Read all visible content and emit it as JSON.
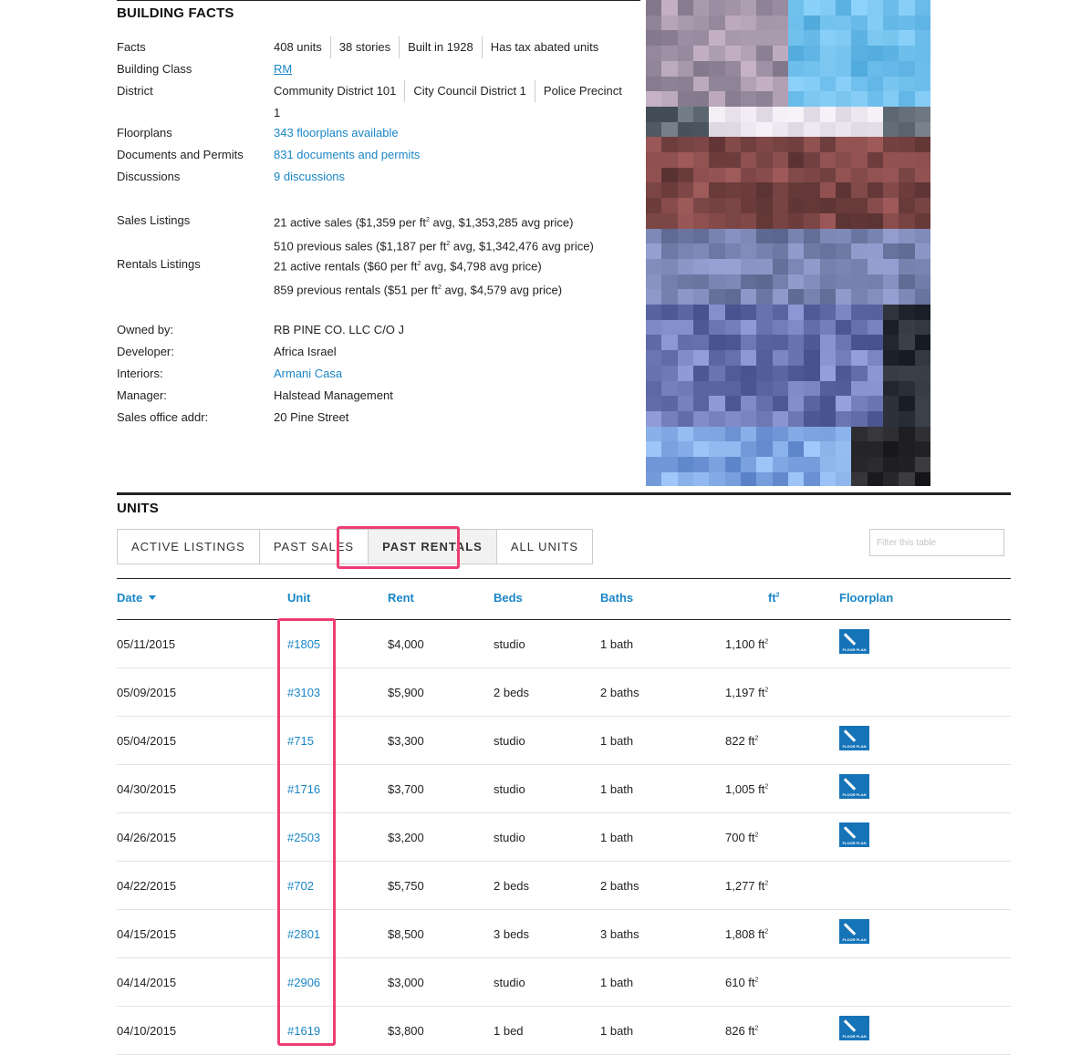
{
  "facts_section": {
    "title": "BUILDING FACTS",
    "rows": [
      {
        "label": "Facts",
        "values": [
          "408 units",
          "38 stories",
          "Built in 1928",
          "Has tax abated units"
        ]
      },
      {
        "label": "Building Class",
        "link": "RM"
      },
      {
        "label": "District",
        "values": [
          "Community District 101",
          "City Council District 1",
          "Police Precinct"
        ],
        "wrap": "1"
      },
      {
        "label": "Floorplans",
        "link": "343 floorplans available"
      },
      {
        "label": "Documents and Permits",
        "link": "831 documents and permits"
      },
      {
        "label": "Discussions",
        "link": "9 discussions"
      },
      {
        "label": "Sales Listings",
        "line1": {
          "pre": "21 active sales ($1,359 per ft",
          "post": " avg, $1,353,285 avg price)"
        },
        "line2": {
          "pre": "510 previous sales ($1,187 per ft",
          "post": " avg, $1,342,476 avg price)"
        }
      },
      {
        "label": "Rentals Listings",
        "line1": {
          "pre": "21 active rentals ($60 per ft",
          "post": " avg, $4,798 avg price)"
        },
        "line2": {
          "pre": "859 previous rentals ($51 per ft",
          "post": " avg, $4,579 avg price)"
        }
      },
      {
        "label": "Owned by:",
        "text": "RB PINE CO. LLC C/O J"
      },
      {
        "label": "Developer:",
        "text": "Africa Israel"
      },
      {
        "label": "Interiors:",
        "link": "Armani Casa"
      },
      {
        "label": "Manager:",
        "text": "Halstead Management"
      },
      {
        "label": "Sales office addr:",
        "text": "20 Pine Street"
      }
    ],
    "superscript": "2"
  },
  "units_section": {
    "title": "UNITS",
    "tabs": [
      "ACTIVE LISTINGS",
      "PAST SALES",
      "PAST RENTALS",
      "ALL UNITS"
    ],
    "active_tab": "PAST RENTALS",
    "filter_placeholder": "Filter this table",
    "columns": [
      "Date",
      "Unit",
      "Rent",
      "Beds",
      "Baths",
      "ft",
      "Floorplan"
    ],
    "floorplan_badge": "FLOOR PLAN",
    "rows": [
      {
        "date": "05/11/2015",
        "unit": "#1805",
        "rent": "$4,000",
        "beds": "studio",
        "baths": "1 bath",
        "ft": "1,100 ft",
        "floorplan": true
      },
      {
        "date": "05/09/2015",
        "unit": "#3103",
        "rent": "$5,900",
        "beds": "2 beds",
        "baths": "2 baths",
        "ft": "1,197 ft",
        "floorplan": false
      },
      {
        "date": "05/04/2015",
        "unit": "#715",
        "rent": "$3,300",
        "beds": "studio",
        "baths": "1 bath",
        "ft": "822 ft",
        "floorplan": true
      },
      {
        "date": "04/30/2015",
        "unit": "#1716",
        "rent": "$3,700",
        "beds": "studio",
        "baths": "1 bath",
        "ft": "1,005 ft",
        "floorplan": true
      },
      {
        "date": "04/26/2015",
        "unit": "#2503",
        "rent": "$3,200",
        "beds": "studio",
        "baths": "1 bath",
        "ft": "700 ft",
        "floorplan": true
      },
      {
        "date": "04/22/2015",
        "unit": "#702",
        "rent": "$5,750",
        "beds": "2 beds",
        "baths": "2 baths",
        "ft": "1,277 ft",
        "floorplan": false
      },
      {
        "date": "04/15/2015",
        "unit": "#2801",
        "rent": "$8,500",
        "beds": "3 beds",
        "baths": "3 baths",
        "ft": "1,808 ft",
        "floorplan": true
      },
      {
        "date": "04/14/2015",
        "unit": "#2906",
        "rent": "$3,000",
        "beds": "studio",
        "baths": "1 bath",
        "ft": "610 ft",
        "floorplan": false
      },
      {
        "date": "04/10/2015",
        "unit": "#1619",
        "rent": "$3,800",
        "beds": "1 bed",
        "baths": "1 bath",
        "ft": "826 ft",
        "floorplan": true
      }
    ]
  },
  "colors": {
    "link": "#1a86c6",
    "highlight": "#ee3d73",
    "floorplan_badge": "#1574b8"
  }
}
